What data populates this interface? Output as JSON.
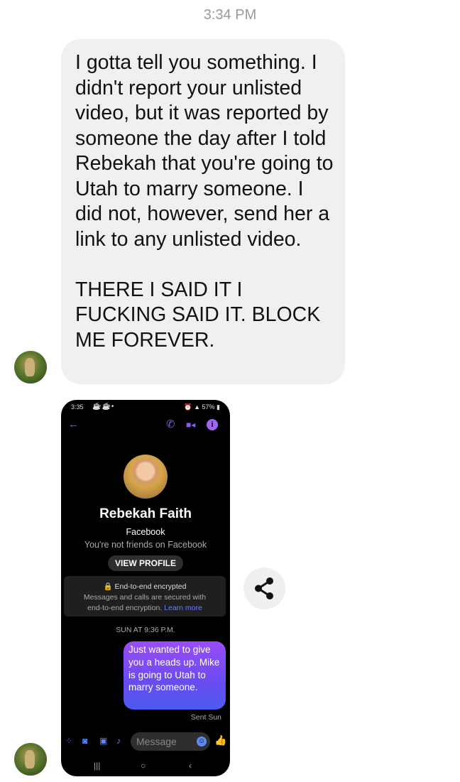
{
  "timestamp": "3:34 PM",
  "message": {
    "paragraph1": "I gotta tell you something. I didn't report your unlisted video, but it was reported by someone the day after I told Rebekah that you're going to Utah to marry someone. I did not, however, send her a link to any unlisted video.",
    "paragraph2": "THERE I SAID IT I FUCKING SAID IT. BLOCK ME FOREVER."
  },
  "screenshot": {
    "status_time": "3:35",
    "status_battery": "57%",
    "contact_name": "Rebekah Faith",
    "platform": "Facebook",
    "friend_status": "You're not friends on Facebook",
    "view_profile": "VIEW PROFILE",
    "encryption_title": "End-to-end encrypted",
    "encryption_desc_1": "Messages and calls are secured with",
    "encryption_desc_2": "end-to-end encryption.",
    "learn_more": "Learn more",
    "day_stamp": "SUN AT 9:36 P.M.",
    "sent_message": "Just wanted to give you a heads up. Mike is going to Utah to marry someone.",
    "sent_status": "Sent Sun",
    "input_placeholder": "Message"
  },
  "icons": {
    "accent_color": "#8a5cf6",
    "compose_color": "#5b8bf6"
  }
}
